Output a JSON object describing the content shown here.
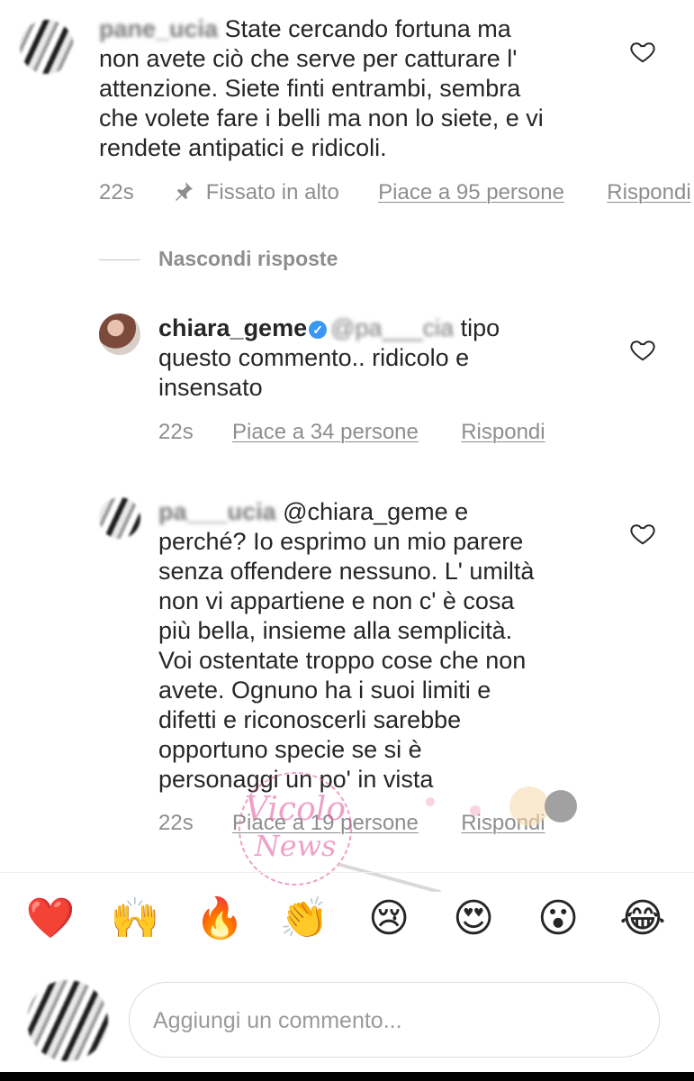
{
  "comments": [
    {
      "username_blurred": "pane_ucia",
      "text_lines": [
        "State cercando fortuna ma",
        "non avete ciò che serve per catturare l'",
        "attenzione. Siete finti entrambi, sembra",
        "che volete fare i belli ma non lo siete, e vi",
        "rendete antipatici e ridicoli."
      ],
      "time": "22s",
      "pinned_label": "Fissato in alto",
      "likes_label": "Piace a 95 persone",
      "reply_label": "Rispondi"
    }
  ],
  "hide_replies_label": "Nascondi risposte",
  "replies": [
    {
      "username": "chiara_geme",
      "verified": true,
      "mention_blurred": "@pa___cia",
      "text_lines": [
        "tipo",
        "questo commento.. ridicolo e",
        "insensato"
      ],
      "time": "22s",
      "likes_label": "Piace a 34 persone",
      "reply_label": "Rispondi"
    },
    {
      "username_blurred": "pa___ucia",
      "mention": "@chiara_geme",
      "text_lines": [
        "e",
        "perché? Io esprimo un mio parere",
        "senza offendere nessuno. L' umiltà",
        "non vi appartiene e non c' è cosa",
        "più bella, insieme alla semplicità.",
        "Voi ostentate troppo cose che non",
        "avete. Ognuno ha i suoi limiti e",
        "difetti e riconoscerli sarebbe",
        "opportuno specie se si è",
        "personaggi un po' in vista"
      ],
      "time": "22s",
      "likes_label": "Piace a 19 persone",
      "reply_label": "Rispondi"
    }
  ],
  "emoji_bar": [
    "❤️",
    "🙌",
    "🔥",
    "👏",
    "😢",
    "😍",
    "😮",
    "😂"
  ],
  "comment_input": {
    "placeholder": "Aggiungi un commento..."
  },
  "watermark": {
    "text_line1": "Vicolo",
    "text_line2": "News"
  },
  "colors": {
    "verified": "#3897f0",
    "meta_gray": "#8e8e8e",
    "text": "#262626",
    "watermark": "#e0559a"
  }
}
